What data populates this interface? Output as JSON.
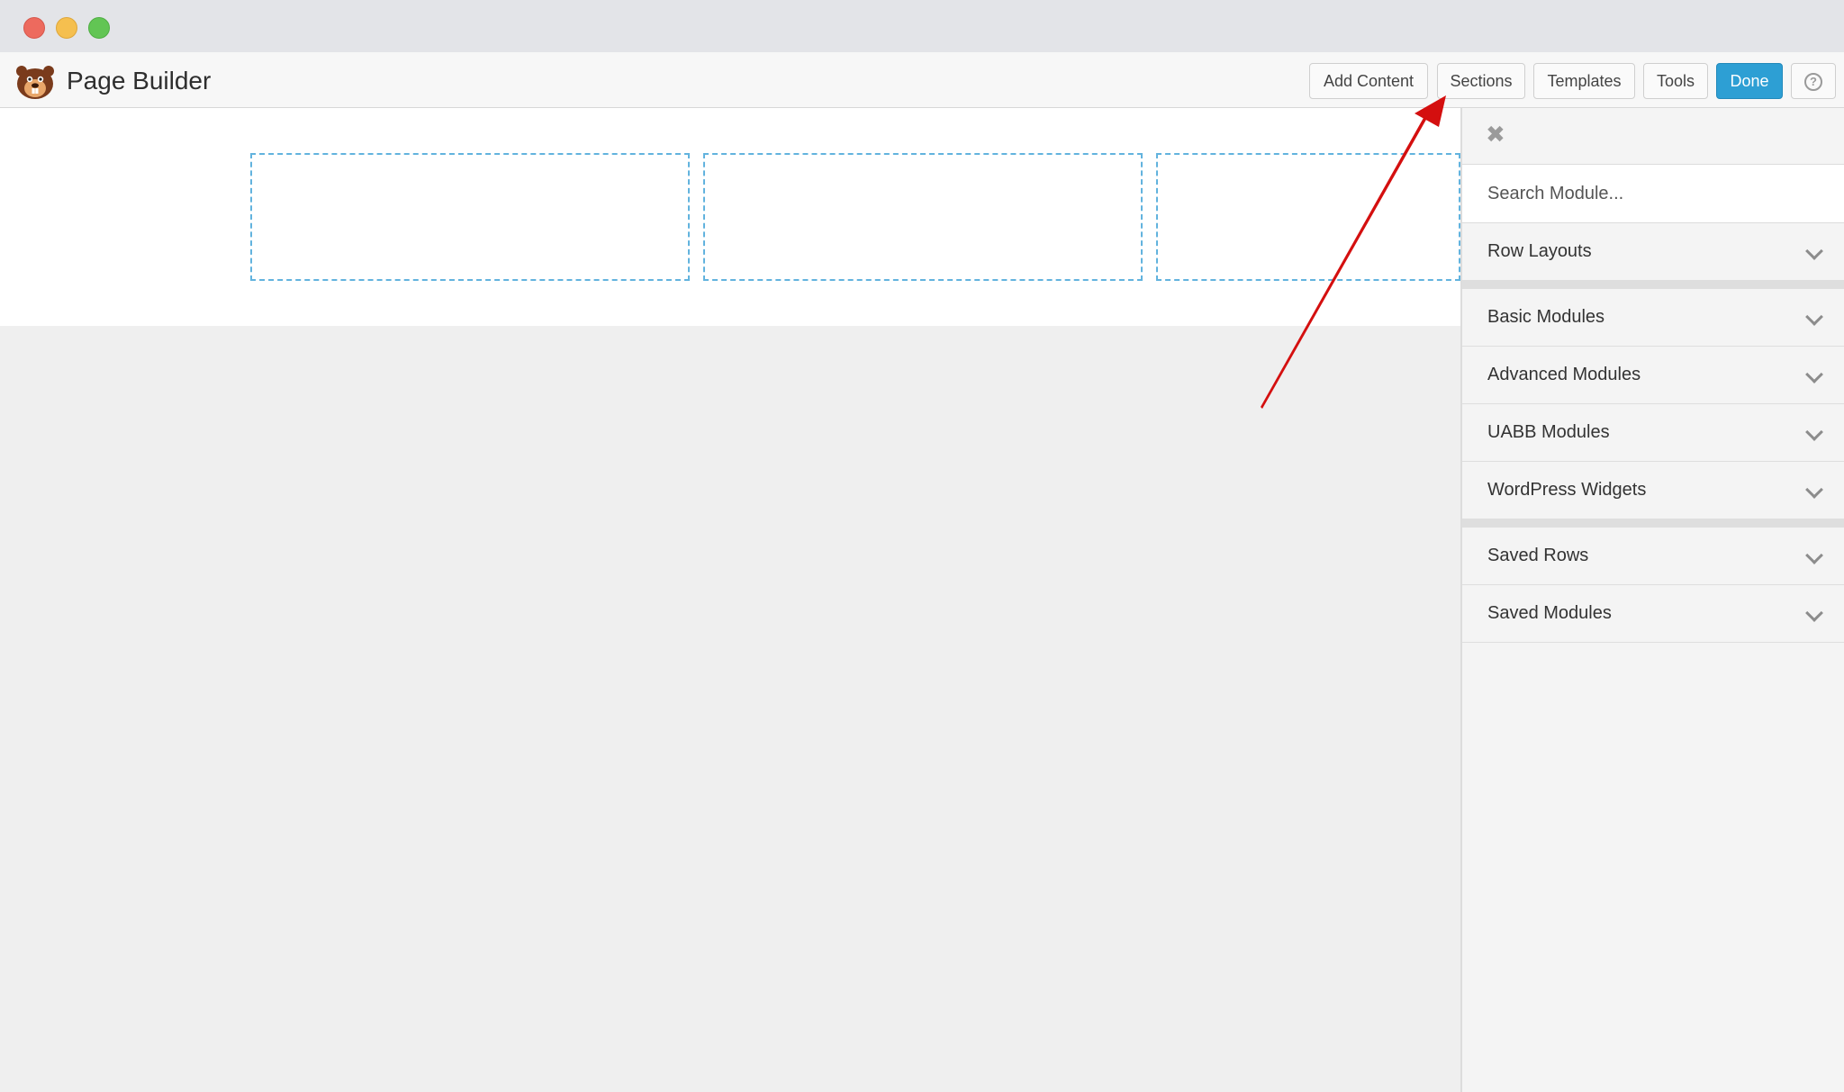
{
  "app": {
    "title": "Page Builder"
  },
  "toolbar": {
    "buttons": {
      "add_content": "Add Content",
      "sections": "Sections",
      "templates": "Templates",
      "tools": "Tools",
      "done": "Done"
    },
    "help_symbol": "?"
  },
  "panel": {
    "close_symbol": "✖",
    "search": {
      "placeholder": "Search Module...",
      "value": ""
    },
    "sections": [
      {
        "label": "Row Layouts"
      },
      {
        "label": "Basic Modules"
      },
      {
        "label": "Advanced Modules"
      },
      {
        "label": "UABB Modules"
      },
      {
        "label": "WordPress Widgets"
      },
      {
        "label": "Saved Rows"
      },
      {
        "label": "Saved Modules"
      }
    ]
  },
  "colors": {
    "accent": "#2d9fd4",
    "drop_zone_border": "#62b3de",
    "annotation_arrow": "#d40f0f"
  },
  "icons": {
    "logo": "beaver-logo-icon",
    "close": "close-icon",
    "help": "help-icon",
    "chevron": "chevron-down-icon"
  }
}
